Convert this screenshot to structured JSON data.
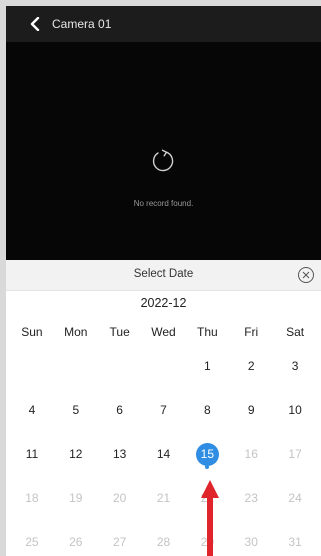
{
  "header": {
    "title": "Camera 01"
  },
  "video": {
    "status_text": "No record found."
  },
  "sheet": {
    "title": "Select Date",
    "month": "2022-12",
    "weekdays": [
      "Sun",
      "Mon",
      "Tue",
      "Wed",
      "Thu",
      "Fri",
      "Sat"
    ],
    "weeks": [
      [
        "",
        "",
        "",
        "",
        "1",
        "2",
        "3"
      ],
      [
        "4",
        "5",
        "6",
        "7",
        "8",
        "9",
        "10"
      ],
      [
        "11",
        "12",
        "13",
        "14",
        "15",
        "16",
        "17"
      ],
      [
        "18",
        "19",
        "20",
        "21",
        "22",
        "23",
        "24"
      ],
      [
        "25",
        "26",
        "27",
        "28",
        "29",
        "30",
        "31"
      ]
    ],
    "selected_day": "15"
  },
  "colors": {
    "accent": "#2f8ee3",
    "annotation_arrow": "#e0242b"
  },
  "icons": {
    "back": "chevron-left-icon",
    "refresh": "refresh-icon",
    "close": "close-circle-icon",
    "arrow": "red-up-arrow-icon"
  }
}
